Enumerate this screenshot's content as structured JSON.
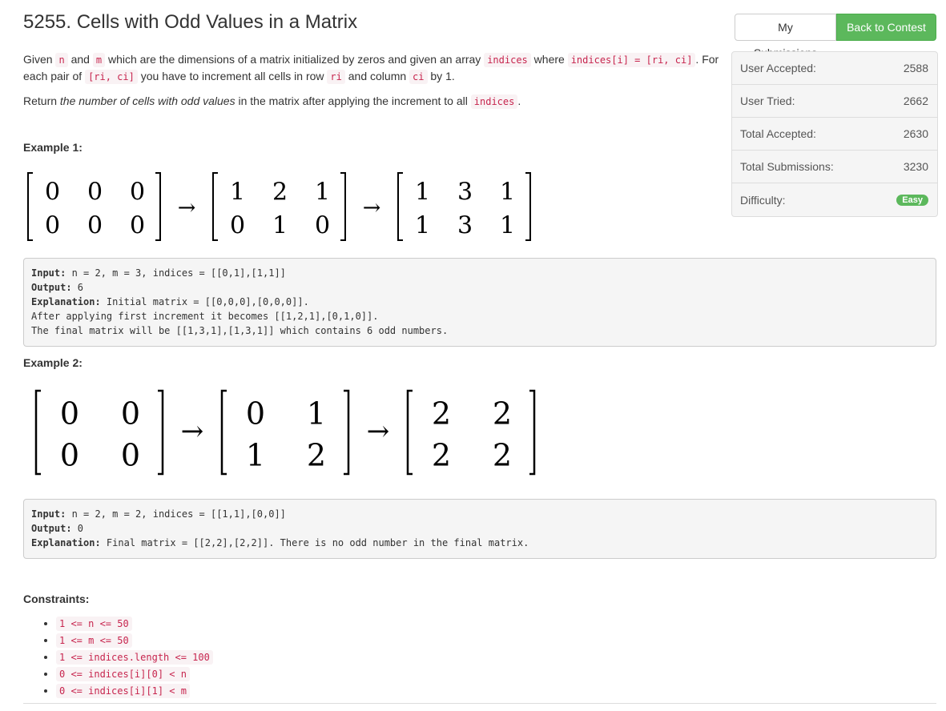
{
  "problem": {
    "title": "5255. Cells with Odd Values in a Matrix"
  },
  "buttons": {
    "my_submissions": "My Submissions",
    "back_to_contest": "Back to Contest"
  },
  "stats": [
    {
      "label": "User Accepted:",
      "value": "2588"
    },
    {
      "label": "User Tried:",
      "value": "2662"
    },
    {
      "label": "Total Accepted:",
      "value": "2630"
    },
    {
      "label": "Total Submissions:",
      "value": "3230"
    }
  ],
  "difficulty": {
    "label": "Difficulty:",
    "value": "Easy"
  },
  "description": {
    "p1_given": "Given ",
    "p1_n": "n",
    "p1_and": " and ",
    "p1_m": "m",
    "p1_mid": " which are the dimensions of a matrix initialized by zeros and given an array ",
    "p1_indices": "indices",
    "p1_where": " where ",
    "p1_indices_i": "indices[i] = [ri, ci]",
    "p1_for": ". For each pair of ",
    "p1_rici": "[ri, ci]",
    "p1_inc": " you have to increment all cells in row ",
    "p1_ri": "ri",
    "p1_col": " and column ",
    "p1_ci": "ci",
    "p1_by": " by 1.",
    "p2_return": "Return ",
    "p2_em": "the number of cells with odd values",
    "p2_rest": " in the matrix after applying the increment to all ",
    "p2_indices": "indices",
    "p2_end": "."
  },
  "example1": {
    "heading": "Example 1:",
    "matrices": [
      [
        [
          "0",
          "0",
          "0"
        ],
        [
          "0",
          "0",
          "0"
        ]
      ],
      [
        [
          "1",
          "2",
          "1"
        ],
        [
          "0",
          "1",
          "0"
        ]
      ],
      [
        [
          "1",
          "3",
          "1"
        ],
        [
          "1",
          "3",
          "1"
        ]
      ]
    ],
    "input_label": "Input:",
    "input": " n = 2, m = 3, indices = [[0,1],[1,1]]",
    "output_label": "Output:",
    "output": " 6",
    "explanation_label": "Explanation:",
    "explanation": " Initial matrix = [[0,0,0],[0,0,0]].",
    "line4": "After applying first increment it becomes [[1,2,1],[0,1,0]].",
    "line5": "The final matrix will be [[1,3,1],[1,3,1]] which contains 6 odd numbers."
  },
  "example2": {
    "heading": "Example 2:",
    "matrices": [
      [
        [
          "0",
          "0"
        ],
        [
          "0",
          "0"
        ]
      ],
      [
        [
          "0",
          "1"
        ],
        [
          "1",
          "2"
        ]
      ],
      [
        [
          "2",
          "2"
        ],
        [
          "2",
          "2"
        ]
      ]
    ],
    "input_label": "Input:",
    "input": " n = 2, m = 2, indices = [[1,1],[0,0]]",
    "output_label": "Output:",
    "output": " 0",
    "explanation_label": "Explanation:",
    "explanation": " Final matrix = [[2,2],[2,2]]. There is no odd number in the final matrix."
  },
  "constraints": {
    "heading": "Constraints:",
    "items": [
      "1 <= n <= 50",
      "1 <= m <= 50",
      "1 <= indices.length <= 100",
      "0 <= indices[i][0] < n",
      "0 <= indices[i][1] < m"
    ]
  }
}
